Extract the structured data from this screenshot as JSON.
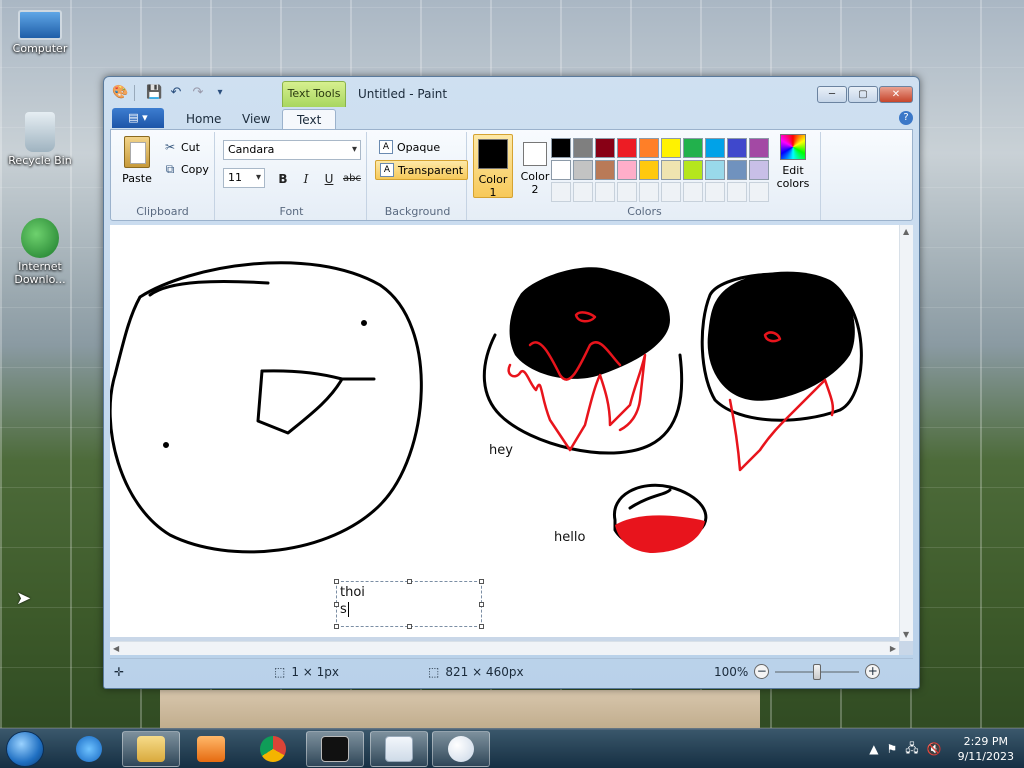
{
  "desktop": {
    "icons": [
      {
        "label": "Computer"
      },
      {
        "label": "Recycle Bin"
      },
      {
        "label": "Internet Downlo..."
      }
    ]
  },
  "window": {
    "title": "Untitled - Paint",
    "context_tab": "Text Tools",
    "tabs": [
      {
        "label": "Home"
      },
      {
        "label": "View"
      },
      {
        "label": "Text"
      }
    ],
    "file_menu_icon": "file-menu-icon",
    "minimize": "─",
    "maximize": "▢",
    "close": "✕"
  },
  "ribbon": {
    "clipboard": {
      "label": "Clipboard",
      "paste": "Paste",
      "cut": "Cut",
      "copy": "Copy"
    },
    "font": {
      "label": "Font",
      "family": "Candara",
      "size": "11",
      "bold": "B",
      "italic": "I",
      "underline": "U",
      "strike": "abc"
    },
    "background": {
      "label": "Background",
      "opaque": "Opaque",
      "transparent": "Transparent"
    },
    "colors": {
      "label": "Colors",
      "color1_line1": "Color",
      "color1_line2": "1",
      "color2_line1": "Color",
      "color2_line2": "2",
      "edit_line1": "Edit",
      "edit_line2": "colors",
      "color1_value": "#000000",
      "color2_value": "#ffffff",
      "palette": [
        "#000000",
        "#7f7f7f",
        "#880015",
        "#ed1c24",
        "#ff7f27",
        "#fff200",
        "#22b14c",
        "#00a2e8",
        "#3f48cc",
        "#a349a4",
        "#ffffff",
        "#c3c3c3",
        "#b97a57",
        "#ffaec9",
        "#ffc90e",
        "#efe4b0",
        "#b5e61d",
        "#99d9ea",
        "#7092be",
        "#c8bfe7"
      ]
    }
  },
  "canvas": {
    "labels": {
      "hey": "hey",
      "hello": "hello"
    },
    "textbox_lines": [
      "thoi",
      "s"
    ],
    "stroke_black": "#000000",
    "stroke_red": "#e8141c"
  },
  "status": {
    "selection": "1 × 1px",
    "canvas_size": "821 × 460px",
    "zoom": "100%"
  },
  "taskbar": {
    "time": "2:29 PM",
    "date": "9/11/2023"
  }
}
